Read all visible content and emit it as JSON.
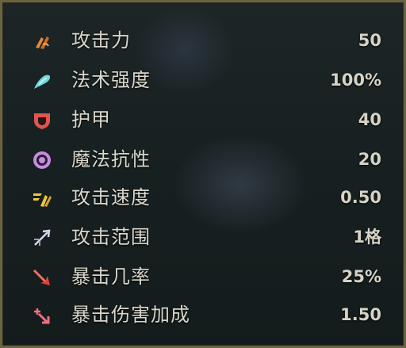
{
  "stats": [
    {
      "icon": "attack-damage-icon",
      "label": "攻击力",
      "value": "50"
    },
    {
      "icon": "ability-power-icon",
      "label": "法术强度",
      "value": "100%"
    },
    {
      "icon": "armor-icon",
      "label": "护甲",
      "value": "40"
    },
    {
      "icon": "magic-resist-icon",
      "label": "魔法抗性",
      "value": "20"
    },
    {
      "icon": "attack-speed-icon",
      "label": "攻击速度",
      "value": "0.50"
    },
    {
      "icon": "attack-range-icon",
      "label": "攻击范围",
      "value": "1格"
    },
    {
      "icon": "crit-chance-icon",
      "label": "暴击几率",
      "value": "25%"
    },
    {
      "icon": "crit-damage-icon",
      "label": "暴击伤害加成",
      "value": "1.50"
    }
  ],
  "colors": {
    "attack": "#e08a3c",
    "ability_power": "#6fd8dc",
    "armor": "#e0564f",
    "magic_resist": "#c58de0",
    "attack_speed": "#f0c63a",
    "range": "#d6d6e6",
    "crit": "#e0403e",
    "crit_damage": "#f07080",
    "border": "#6b6340"
  }
}
